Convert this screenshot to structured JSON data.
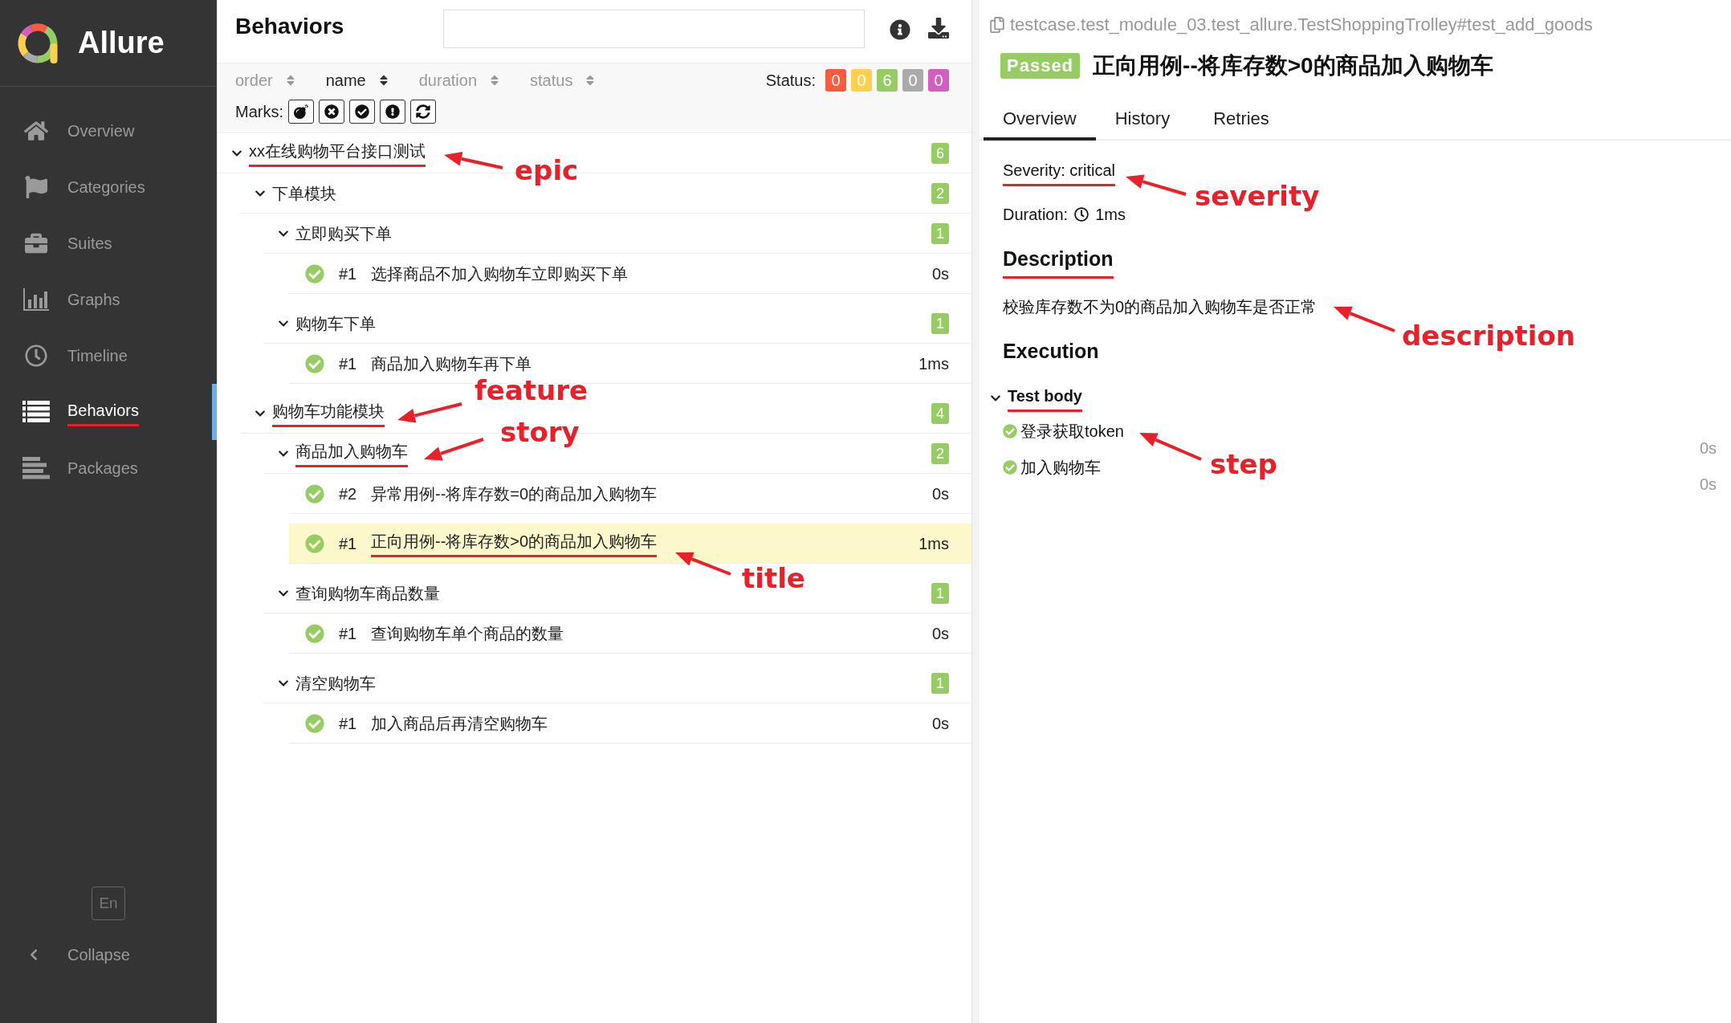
{
  "sidebar": {
    "brand": "Allure",
    "items": [
      {
        "label": "Overview",
        "selected": false,
        "underlined": false
      },
      {
        "label": "Categories",
        "selected": false,
        "underlined": false
      },
      {
        "label": "Suites",
        "selected": false,
        "underlined": false
      },
      {
        "label": "Graphs",
        "selected": false,
        "underlined": false
      },
      {
        "label": "Timeline",
        "selected": false,
        "underlined": false
      },
      {
        "label": "Behaviors",
        "selected": true,
        "underlined": true
      },
      {
        "label": "Packages",
        "selected": false,
        "underlined": false
      }
    ],
    "language": "En",
    "collapse": "Collapse"
  },
  "tree_panel": {
    "title": "Behaviors",
    "sort_columns": [
      {
        "label": "order",
        "selected": false
      },
      {
        "label": "name",
        "selected": true
      },
      {
        "label": "duration",
        "selected": false
      },
      {
        "label": "status",
        "selected": false
      }
    ],
    "status_label": "Status:",
    "status_counts": [
      {
        "count": "0",
        "color": "#fd5a3e"
      },
      {
        "count": "0",
        "color": "#ffd050"
      },
      {
        "count": "6",
        "color": "#97cc64"
      },
      {
        "count": "0",
        "color": "#aaaaaa"
      },
      {
        "count": "0",
        "color": "#d35ebe"
      }
    ],
    "marks_label": "Marks:",
    "tree": [
      {
        "kind": "group",
        "name": "xx在线购物平台接口测试",
        "count": "6",
        "expanded": true,
        "underlined": true,
        "children": [
          {
            "kind": "group",
            "name": "下单模块",
            "count": "2",
            "expanded": true,
            "underlined": false,
            "children": [
              {
                "kind": "group",
                "name": "立即购买下单",
                "count": "1",
                "expanded": true,
                "underlined": false,
                "children": [
                  {
                    "kind": "test",
                    "number": "#1",
                    "name": "选择商品不加入购物车立即购买下单",
                    "duration": "0s",
                    "selected": false,
                    "underlined": false
                  }
                ]
              },
              {
                "kind": "group",
                "name": "购物车下单",
                "count": "1",
                "expanded": true,
                "underlined": false,
                "children": [
                  {
                    "kind": "test",
                    "number": "#1",
                    "name": "商品加入购物车再下单",
                    "duration": "1ms",
                    "selected": false,
                    "underlined": false
                  }
                ]
              }
            ]
          },
          {
            "kind": "group",
            "name": "购物车功能模块",
            "count": "4",
            "expanded": true,
            "underlined": true,
            "children": [
              {
                "kind": "group",
                "name": "商品加入购物车",
                "count": "2",
                "expanded": true,
                "underlined": true,
                "children": [
                  {
                    "kind": "test",
                    "number": "#2",
                    "name": "异常用例--将库存数=0的商品加入购物车",
                    "duration": "0s",
                    "selected": false,
                    "underlined": false
                  },
                  {
                    "kind": "test",
                    "number": "#1",
                    "name": "正向用例--将库存数>0的商品加入购物车",
                    "duration": "1ms",
                    "selected": true,
                    "underlined": true
                  }
                ]
              },
              {
                "kind": "group",
                "name": "查询购物车商品数量",
                "count": "1",
                "expanded": true,
                "underlined": false,
                "children": [
                  {
                    "kind": "test",
                    "number": "#1",
                    "name": "查询购物车单个商品的数量",
                    "duration": "0s",
                    "selected": false,
                    "underlined": false
                  }
                ]
              },
              {
                "kind": "group",
                "name": "清空购物车",
                "count": "1",
                "expanded": true,
                "underlined": false,
                "children": [
                  {
                    "kind": "test",
                    "number": "#1",
                    "name": "加入商品后再清空购物车",
                    "duration": "0s",
                    "selected": false,
                    "underlined": false
                  }
                ]
              }
            ]
          }
        ]
      }
    ]
  },
  "detail": {
    "path": "testcase.test_module_03.test_allure.TestShoppingTrolley#test_add_goods",
    "status": "Passed",
    "title": "正向用例--将库存数>0的商品加入购物车",
    "tabs": [
      {
        "label": "Overview",
        "selected": true
      },
      {
        "label": "History",
        "selected": false
      },
      {
        "label": "Retries",
        "selected": false
      }
    ],
    "severity": "Severity: critical",
    "duration_label": "Duration:",
    "duration": "1ms",
    "description_heading": "Description",
    "description": "校验库存数不为0的商品加入购物车是否正常",
    "execution_heading": "Execution",
    "test_body": {
      "name": "Test body",
      "expanded": true,
      "steps": [
        {
          "name": "登录获取token",
          "duration": "0s"
        },
        {
          "name": "加入购物车",
          "duration": "0s"
        }
      ]
    }
  },
  "annotations": [
    {
      "text": "epic"
    },
    {
      "text": "feature"
    },
    {
      "text": "story"
    },
    {
      "text": "title"
    },
    {
      "text": "severity"
    },
    {
      "text": "description"
    },
    {
      "text": "step"
    }
  ]
}
